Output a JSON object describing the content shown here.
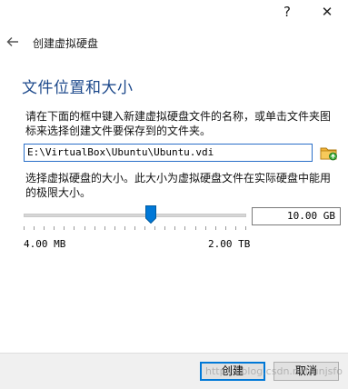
{
  "titlebar": {
    "help": "?",
    "close": "✕"
  },
  "wizard": {
    "title": "创建虚拟硬盘"
  },
  "section": {
    "title": "文件位置和大小"
  },
  "location": {
    "description": "请在下面的框中键入新建虚拟硬盘文件的名称，或单击文件夹图标来选择创建文件要保存到的文件夹。",
    "path": "E:\\VirtualBox\\Ubuntu\\Ubuntu.vdi"
  },
  "size": {
    "description": "选择虚拟硬盘的大小。此大小为虚拟硬盘文件在实际硬盘中能用的极限大小。",
    "value": "10.00 GB",
    "min_label": "4.00 MB",
    "max_label": "2.00 TB",
    "slider_position_fraction": 0.57
  },
  "buttons": {
    "create": "创建",
    "cancel": "取消"
  },
  "watermark": "https://blog.csdn.net/unjsfo"
}
